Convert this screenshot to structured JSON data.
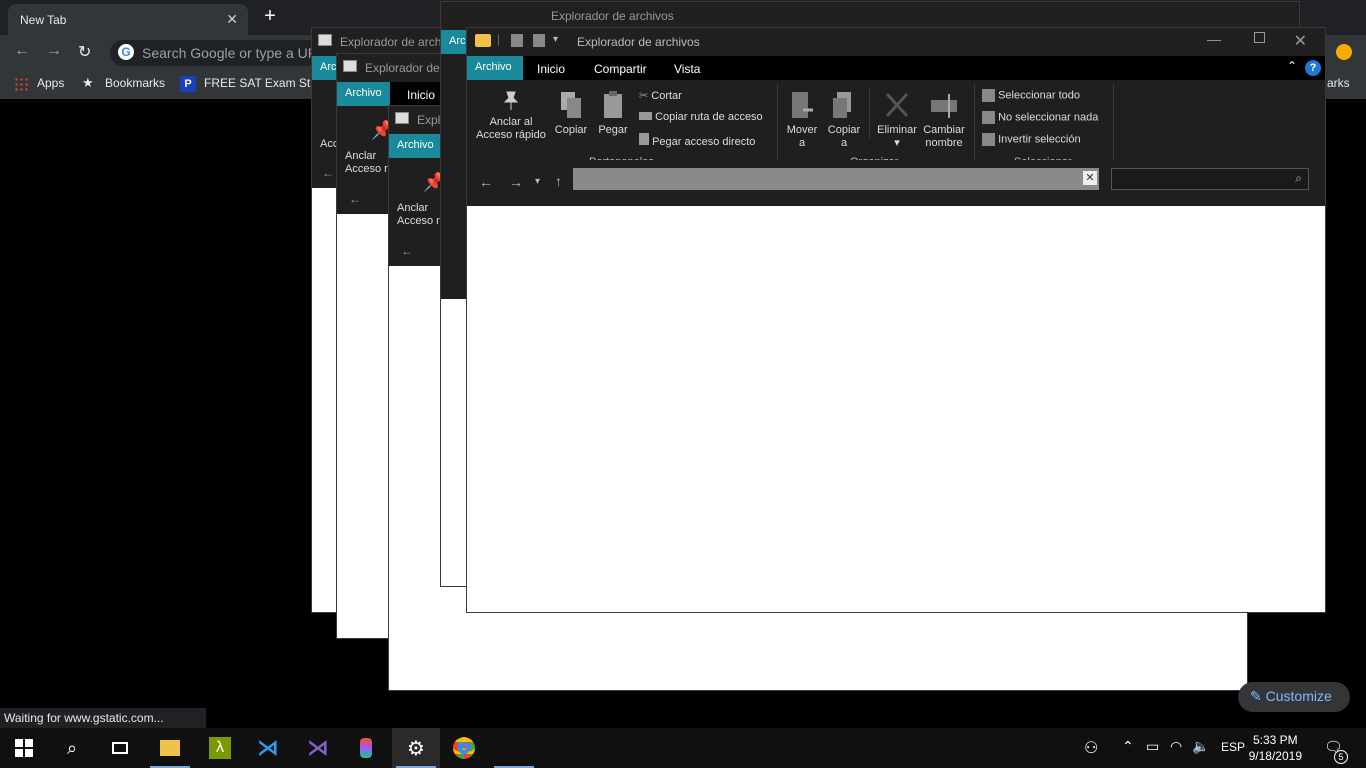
{
  "chrome": {
    "tab_title": "New Tab",
    "tab_close": "✕",
    "new_tab": "+",
    "omnibox_placeholder": "Search Google or type a URL",
    "bookmarks": {
      "apps": "Apps",
      "bookmarks": "Bookmarks",
      "sat": "FREE SAT Exam Stu...",
      "other": "arks"
    },
    "status": "Waiting for www.gstatic.com...",
    "customize": "Customize"
  },
  "explorer": {
    "window_title": "Explorador de archivos",
    "tabs": {
      "archivo": "Archivo",
      "inicio": "Inicio",
      "compartir": "Compartir",
      "vista": "Vista"
    },
    "bg_titles": [
      "Explorador de archi",
      "Explorador de",
      "Explo"
    ],
    "bg_archivo_short": [
      "Arc",
      "Archivo",
      "Archivo",
      "Arc"
    ],
    "bg_inicio": "Inicio",
    "bg_anclar": [
      "Accl",
      "Anclar",
      "Acceso r",
      "Anclar",
      "Acceso r"
    ],
    "ribbon": {
      "anclar": "Anclar al",
      "anclar2": "Acceso rápido",
      "copiar": "Copiar",
      "pegar": "Pegar",
      "cortar": "Cortar",
      "copiar_ruta": "Copiar ruta de acceso",
      "pegar_acceso": "Pegar acceso directo",
      "mover": "Mover",
      "mover2": "a",
      "copiar_a": "Copiar",
      "copiar_a2": "a",
      "eliminar": "Eliminar",
      "cambiar": "Cambiar",
      "nombre": "nombre",
      "sel_todo": "Seleccionar todo",
      "no_sel": "No seleccionar nada",
      "invertir": "Invertir selección",
      "grp_portapapeles": "Portapapeles",
      "grp_organizar": "Organizar",
      "grp_seleccionar": "Seleccionar"
    }
  },
  "taskbar": {
    "lang": "ESP",
    "time": "5:33 PM",
    "date": "9/18/2019",
    "notif_count": "5"
  }
}
